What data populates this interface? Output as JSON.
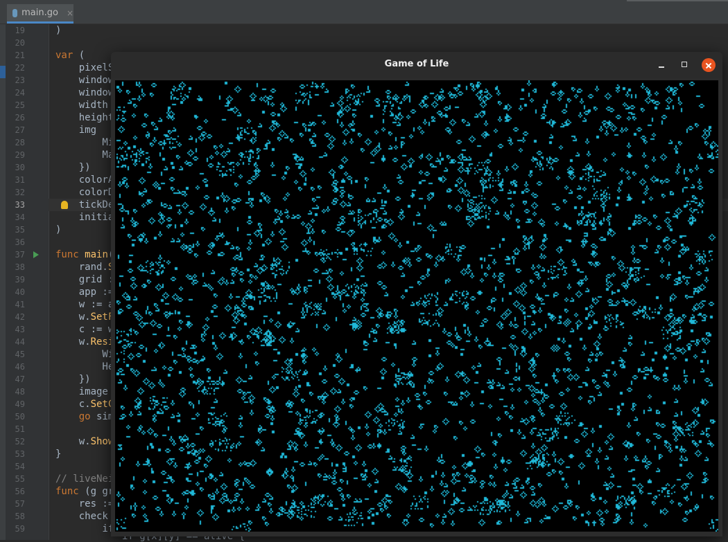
{
  "editor": {
    "tab_label": "main.go",
    "tab_close": "×",
    "current_line": 33,
    "lines": [
      {
        "n": "19",
        "t": ")"
      },
      {
        "n": "20",
        "t": ""
      },
      {
        "n": "21",
        "t": "var ("
      },
      {
        "n": "22",
        "t": "    pixelS"
      },
      {
        "n": "23",
        "t": "    window"
      },
      {
        "n": "24",
        "t": "    window"
      },
      {
        "n": "25",
        "t": "    width"
      },
      {
        "n": "26",
        "t": "    height"
      },
      {
        "n": "27",
        "t": "    img"
      },
      {
        "n": "28",
        "t": "        Mi"
      },
      {
        "n": "29",
        "t": "        Ma"
      },
      {
        "n": "30",
        "t": "    })"
      },
      {
        "n": "31",
        "t": "    colorA"
      },
      {
        "n": "32",
        "t": "    colorD"
      },
      {
        "n": "33",
        "t": "    tickDe"
      },
      {
        "n": "34",
        "t": "    initia"
      },
      {
        "n": "35",
        "t": ")"
      },
      {
        "n": "36",
        "t": ""
      },
      {
        "n": "37",
        "t": "func main("
      },
      {
        "n": "38",
        "t": "    rand.S"
      },
      {
        "n": "39",
        "t": "    grid :"
      },
      {
        "n": "40",
        "t": "    app :="
      },
      {
        "n": "41",
        "t": "    w := a"
      },
      {
        "n": "42",
        "t": "    w.SetF"
      },
      {
        "n": "43",
        "t": "    c := w"
      },
      {
        "n": "44",
        "t": "    w.Resi"
      },
      {
        "n": "45",
        "t": "        Wi"
      },
      {
        "n": "46",
        "t": "        He"
      },
      {
        "n": "47",
        "t": "    })"
      },
      {
        "n": "48",
        "t": "    image"
      },
      {
        "n": "49",
        "t": "    c.SetC"
      },
      {
        "n": "50",
        "t": "    go sim"
      },
      {
        "n": "51",
        "t": ""
      },
      {
        "n": "52",
        "t": "    w.Show"
      },
      {
        "n": "53",
        "t": "}"
      },
      {
        "n": "54",
        "t": ""
      },
      {
        "n": "55",
        "t": "// liveNei"
      },
      {
        "n": "56",
        "t": "func (g gr"
      },
      {
        "n": "57",
        "t": "    res :="
      },
      {
        "n": "58",
        "t": "    check"
      },
      {
        "n": "59",
        "t": "        if"
      }
    ],
    "partial_bottom_line": "if g[x][y] == alive {"
  },
  "window": {
    "title": "Game of Life",
    "cell_color": "#1fb8d8",
    "background_color": "#000000"
  },
  "colors": {
    "editor_bg": "#2b2b2b",
    "close_button": "#e95420",
    "keyword": "#cc7832",
    "function": "#ffc66d"
  }
}
